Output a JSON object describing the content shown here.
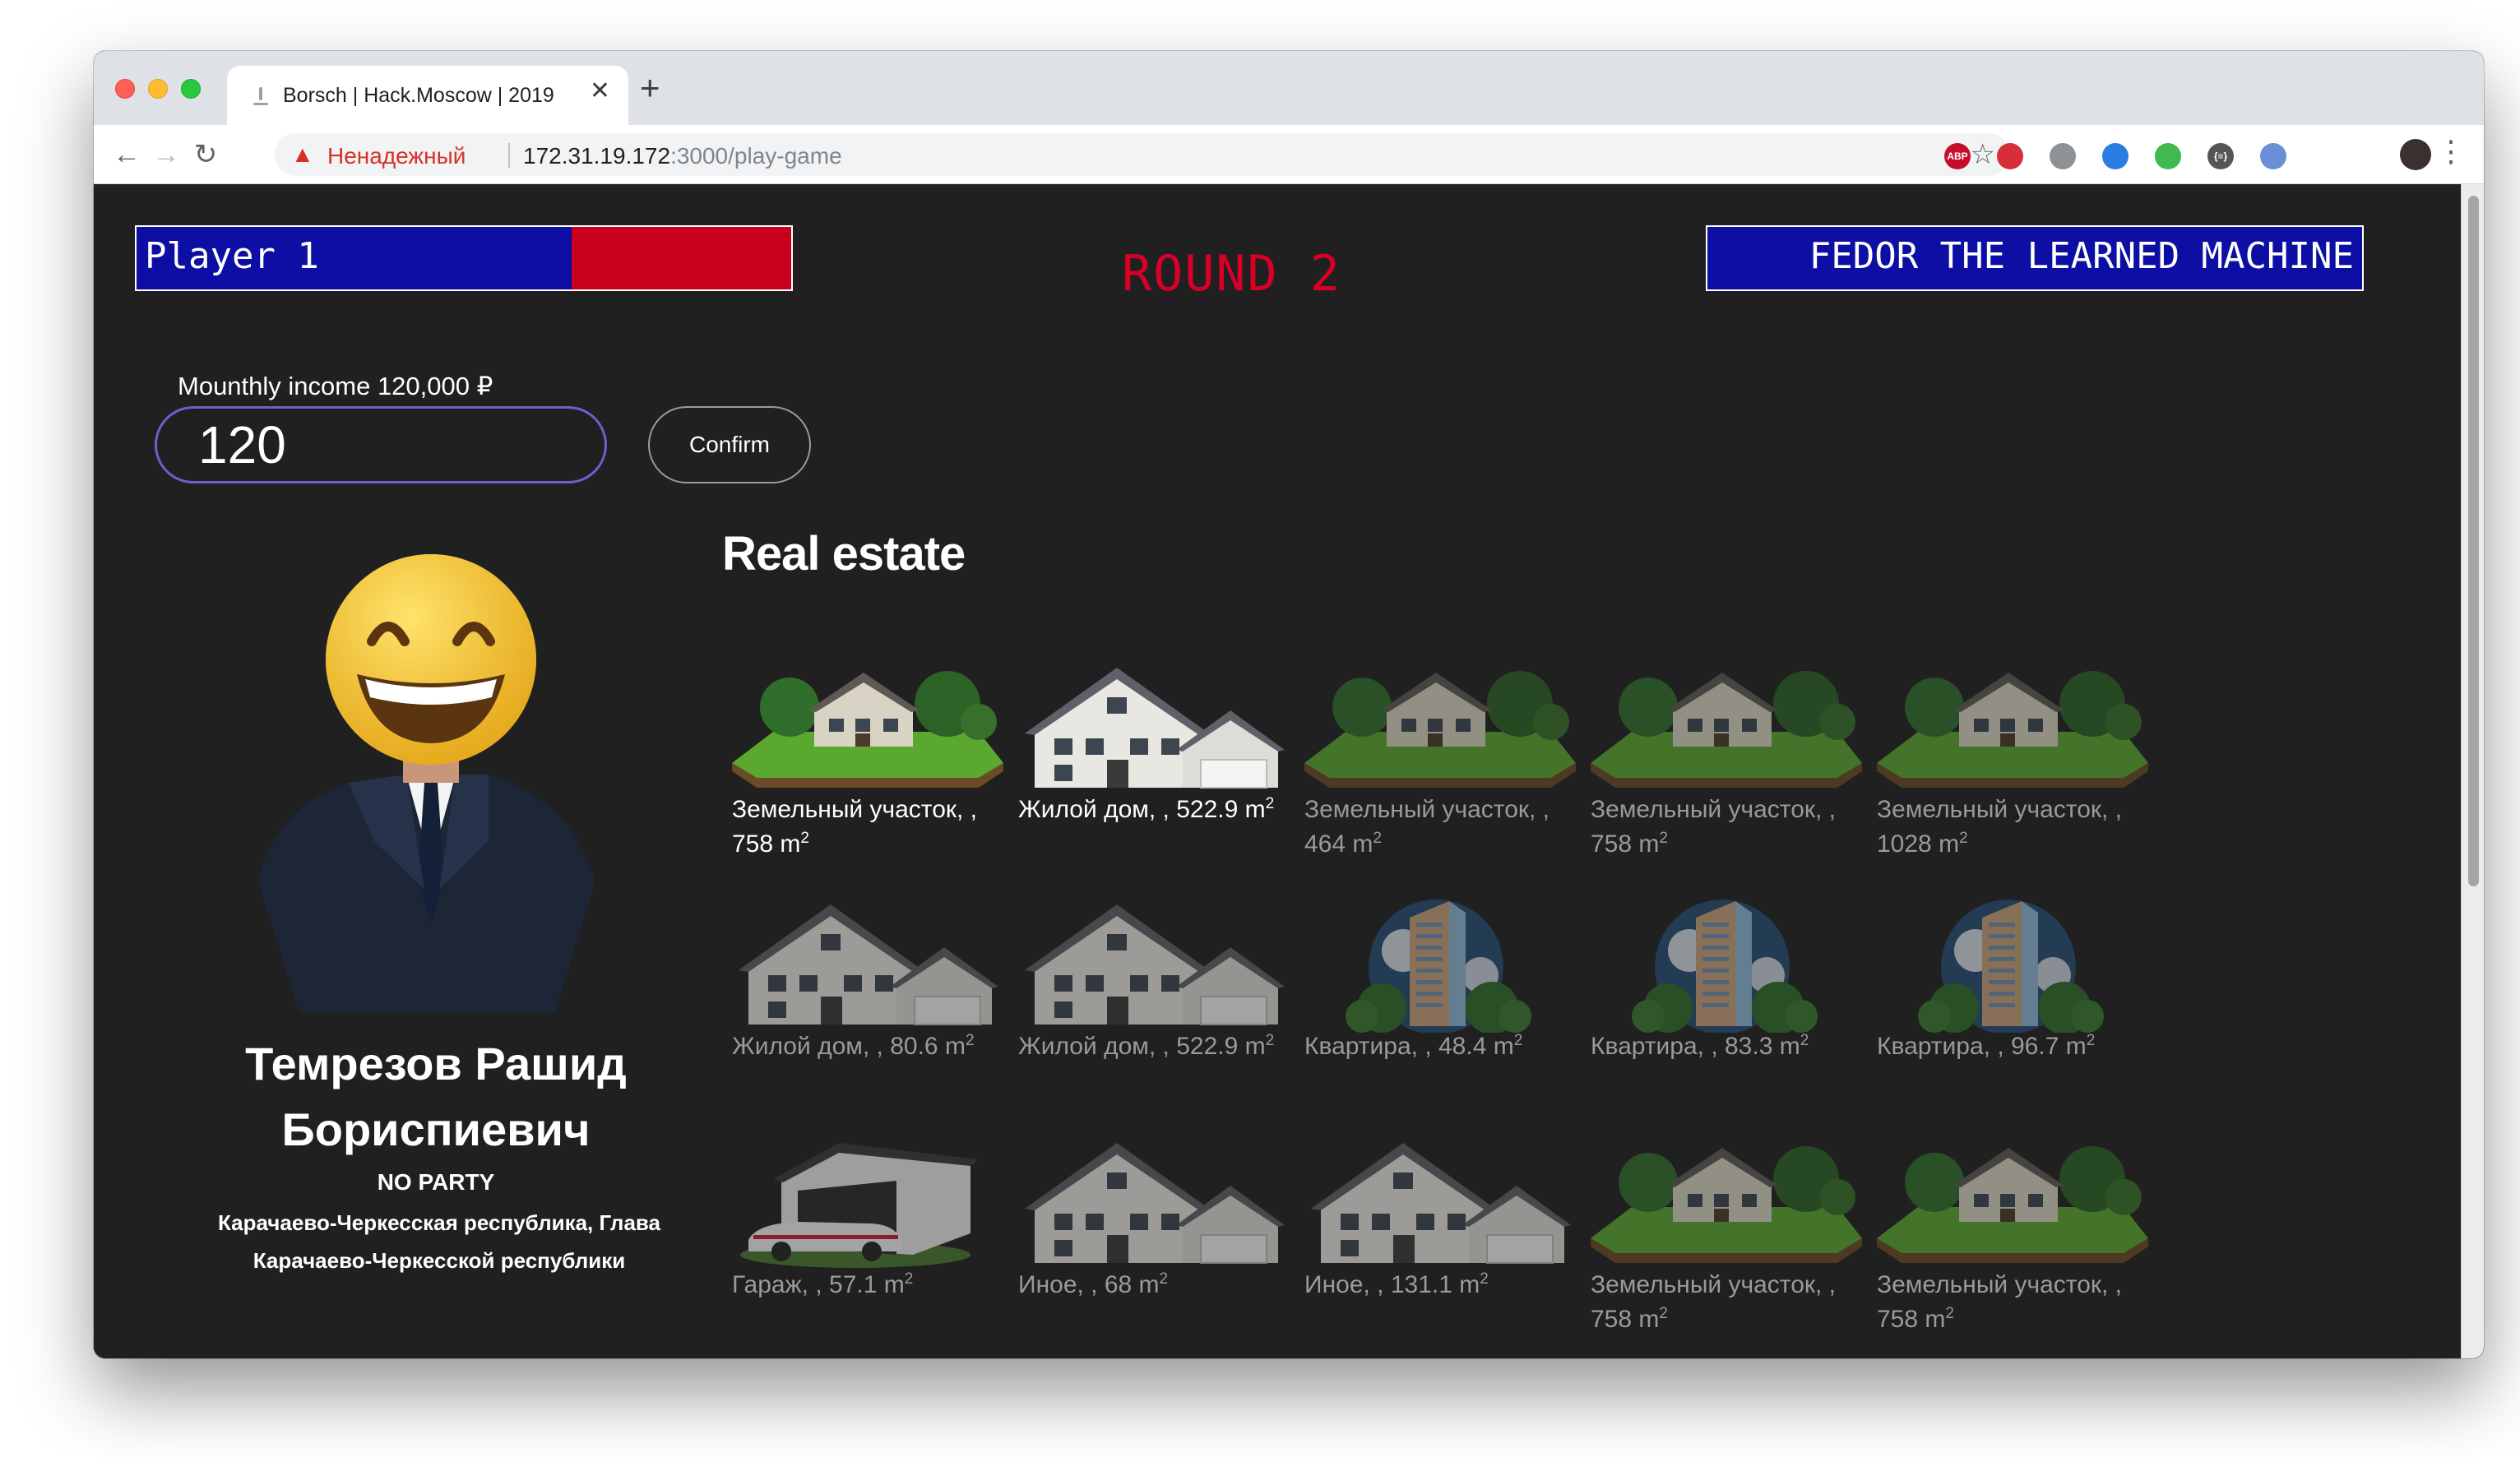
{
  "browser": {
    "tab_title": "Borsch | Hack.Moscow | 2019",
    "not_secure": "Ненадежный",
    "url_host": "172.31.19.172",
    "url_path": ":3000/play-game",
    "extensions": [
      {
        "name": "adblock-plus-icon",
        "label": "ABP",
        "color": "#c70d2c"
      },
      {
        "name": "ext-red-icon",
        "label": "",
        "color": "#d82e3a"
      },
      {
        "name": "globe-icon",
        "label": "",
        "color": "#8d9297"
      },
      {
        "name": "ext-blue-icon",
        "label": "",
        "color": "#2a7de1"
      },
      {
        "name": "ext-green-icon",
        "label": "",
        "color": "#3fb950"
      },
      {
        "name": "json-viewer-icon",
        "label": "{≡}",
        "color": "#555555"
      },
      {
        "name": "ext-compass-icon",
        "label": "",
        "color": "#6b8fd6"
      }
    ]
  },
  "game": {
    "player1": {
      "name": "Player 1",
      "health_fraction": 0.665
    },
    "player2": {
      "name": "FEDOR THE LEARNED MACHINE"
    },
    "round": "ROUND 2",
    "income_label": "Mounthly income 120,000 ₽",
    "income_value": "120",
    "confirm_label": "Confirm",
    "politician": {
      "name": "Темрезов Рашид Бориспиевич",
      "party": "NO PARTY",
      "position": "Карачаево-Черкесская республика, Глава Карачаево-Черкесской республики"
    },
    "real_estate_title": "Real estate",
    "properties": [
      {
        "caption": "Земельный участок, , 758 m",
        "sup": "2",
        "kind": "land",
        "owned": true
      },
      {
        "caption": "Жилой дом, , 522.9 m",
        "sup": "2",
        "kind": "house",
        "owned": true
      },
      {
        "caption": "Земельный участок, , 464 m",
        "sup": "2",
        "kind": "land",
        "owned": false
      },
      {
        "caption": "Земельный участок, , 758 m",
        "sup": "2",
        "kind": "land",
        "owned": false
      },
      {
        "caption": "Земельный участок, , 1028 m",
        "sup": "2",
        "kind": "land",
        "owned": false
      },
      {
        "caption": "Жилой дом, , 80.6 m",
        "sup": "2",
        "kind": "house",
        "owned": false
      },
      {
        "caption": "Жилой дом, , 522.9 m",
        "sup": "2",
        "kind": "house",
        "owned": false
      },
      {
        "caption": "Квартира, , 48.4 m",
        "sup": "2",
        "kind": "tower",
        "owned": false
      },
      {
        "caption": "Квартира, , 83.3 m",
        "sup": "2",
        "kind": "tower",
        "owned": false
      },
      {
        "caption": "Квартира, , 96.7 m",
        "sup": "2",
        "kind": "tower",
        "owned": false
      },
      {
        "caption": "Гараж, , 57.1 m",
        "sup": "2",
        "kind": "garage",
        "owned": false
      },
      {
        "caption": "Иное, , 68 m",
        "sup": "2",
        "kind": "house",
        "owned": false
      },
      {
        "caption": "Иное, , 131.1 m",
        "sup": "2",
        "kind": "house",
        "owned": false
      },
      {
        "caption": "Земельный участок, , 758 m",
        "sup": "2",
        "kind": "land",
        "owned": false
      },
      {
        "caption": "Земельный участок, , 758 m",
        "sup": "2",
        "kind": "land",
        "owned": false
      },
      {
        "caption": "",
        "sup": "",
        "kind": "land",
        "owned": false
      },
      {
        "caption": "",
        "sup": "",
        "kind": "land",
        "owned": false
      },
      {
        "caption": "",
        "sup": "",
        "kind": "house",
        "owned": false
      },
      {
        "caption": "",
        "sup": "",
        "kind": "house",
        "owned": false
      },
      {
        "caption": "",
        "sup": "",
        "kind": "house",
        "owned": false
      }
    ]
  }
}
